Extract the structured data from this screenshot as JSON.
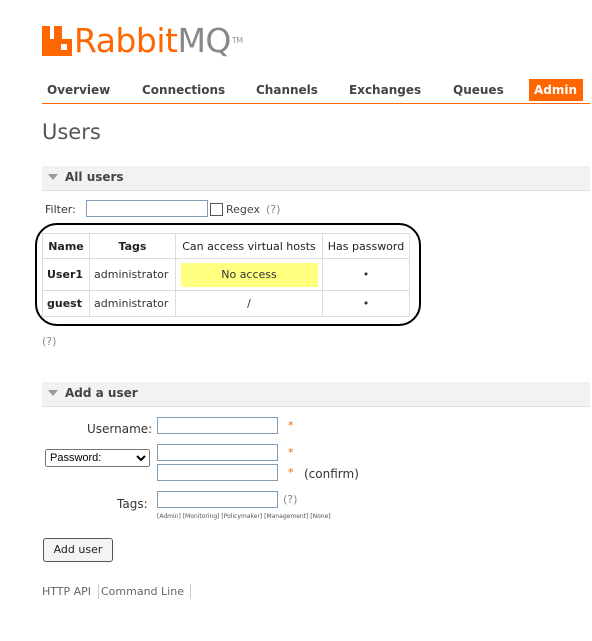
{
  "brand": {
    "rabbit": "Rabbit",
    "mq": "MQ",
    "tm": "TM"
  },
  "nav": [
    {
      "label": "Overview",
      "active": false
    },
    {
      "label": "Connections",
      "active": false
    },
    {
      "label": "Channels",
      "active": false
    },
    {
      "label": "Exchanges",
      "active": false
    },
    {
      "label": "Queues",
      "active": false
    },
    {
      "label": "Admin",
      "active": true
    }
  ],
  "page_title": "Users",
  "all_users": {
    "section_title": "All users",
    "filter_label": "Filter:",
    "filter_value": "",
    "regex_label": "Regex",
    "regex_help": "(?)",
    "columns": [
      "Name",
      "Tags",
      "Can access virtual hosts",
      "Has password"
    ],
    "rows": [
      {
        "name": "User1",
        "tags": "administrator",
        "vhosts": "No access",
        "has_password": "•"
      },
      {
        "name": "guest",
        "tags": "administrator",
        "vhosts": "/",
        "has_password": "•"
      }
    ],
    "help": "(?)"
  },
  "add_user": {
    "section_title": "Add a user",
    "username_label": "Username:",
    "password_select": "Password:",
    "confirm_label": "(confirm)",
    "tags_label": "Tags:",
    "tags_help": "(?)",
    "tag_shortcuts": "[Admin] [Monitoring] [Policymaker] [Management] [None]",
    "required_mark": "*",
    "submit_label": "Add user"
  },
  "footer": {
    "http_api": "HTTP API",
    "command_line": "Command Line"
  },
  "colors": {
    "accent": "#ff6600",
    "highlight": "#ffff80"
  }
}
